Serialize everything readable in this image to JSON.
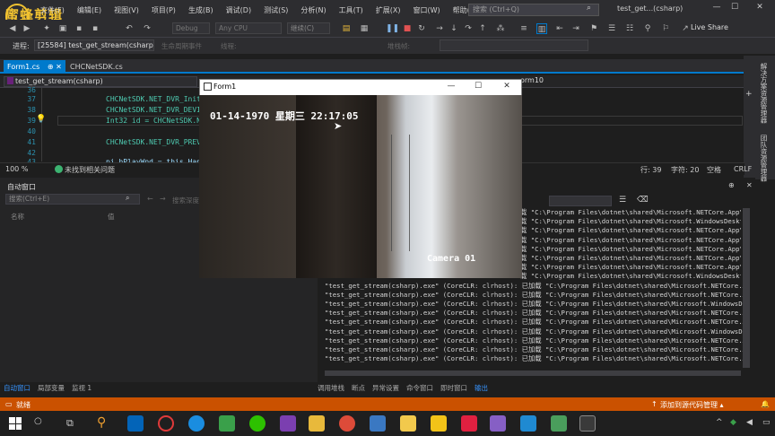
{
  "logo": {
    "text": "蜜蜂剪辑"
  },
  "menu": [
    "文件(F)",
    "编辑(E)",
    "视图(V)",
    "项目(P)",
    "生成(B)",
    "调试(D)",
    "测试(S)",
    "分析(N)",
    "工具(T)",
    "扩展(X)",
    "窗口(W)",
    "帮助(H)"
  ],
  "search": {
    "placeholder": "搜索 (Ctrl+Q)"
  },
  "window_title": "test_get...(csharp)",
  "toolbar": {
    "config": "Debug",
    "platform": "Any CPU",
    "continue": "继续(C)",
    "live_share": "Live Share"
  },
  "toolbar2": {
    "process_label": "进程:",
    "process": "[25584] test_get_stream(csharp",
    "lifecycle": "生命周期事件",
    "thread": "线程:",
    "stack": "堆栈帧:"
  },
  "tabs": [
    {
      "label": "Form1.cs",
      "pin": "⊕ ✕"
    },
    {
      "label": "CHCNetSDK.cs"
    }
  ],
  "nav": {
    "left": "test_get_stream(csharp)",
    "right": "orm10"
  },
  "editor": {
    "lines": [
      {
        "num": "36",
        "code": ""
      },
      {
        "num": "37",
        "code": "CHCNetSDK.NET_DVR_Init("
      },
      {
        "num": "38",
        "code": "CHCNetSDK.NET_DVR_DEVIC"
      },
      {
        "num": "39",
        "code": "Int32 id = CHCNetSDK.NE"
      },
      {
        "num": "40",
        "code": ""
      },
      {
        "num": "41",
        "code": "CHCNetSDK.NET_DVR_PREVI"
      },
      {
        "num": "42",
        "code": ""
      },
      {
        "num": "43",
        "code": "pi.hPlayWnd = this.Hand"
      }
    ]
  },
  "right_panel": {
    "solution": "解决方案资源管理器",
    "team": "团队资源管理器"
  },
  "editor_status": {
    "zoom": "100 %",
    "issues": "未找到相关问题",
    "line": "行: 39",
    "char": "字符: 20",
    "space": "空格",
    "eol": "CRLF"
  },
  "autos": {
    "title": "自动窗口",
    "search_placeholder": "搜索(Ctrl+E)",
    "search_depth": "搜索深度:",
    "col_name": "名称",
    "col_value": "值",
    "tabs": [
      "自动窗口",
      "局部变量",
      "监视 1"
    ]
  },
  "output": {
    "lines": [
      "载 \"C:\\Program Files\\dotnet\\shared\\Microsoft.NETCore.App\\3.1",
      "载 \"C:\\Program Files\\dotnet\\shared\\Microsoft.WindowsDesktop.A",
      "载 \"C:\\Program Files\\dotnet\\shared\\Microsoft.NETCore.App\\3.1",
      "载 \"C:\\Program Files\\dotnet\\shared\\Microsoft.NETCore.App\\3.1",
      "载 \"C:\\Program Files\\dotnet\\shared\\Microsoft.NETCore.App\\3.1",
      "载 \"C:\\Program Files\\dotnet\\shared\\Microsoft.NETCore.App\\3.1",
      "载 \"C:\\Program Files\\dotnet\\shared\\Microsoft.NETCore.App\\3.1",
      "载 \"C:\\Program Files\\dotnet\\shared\\Microsoft.WindowsDesktop.A",
      "\"test_get_stream(csharp).exe\" (CoreCLR: clrhost): 已加载 \"C:\\Program Files\\dotnet\\shared\\Microsoft.NETCore.App\\3.1",
      "\"test_get_stream(csharp).exe\" (CoreCLR: clrhost): 已加载 \"C:\\Program Files\\dotnet\\shared\\Microsoft.NETCore.App\\3.1",
      "\"test_get_stream(csharp).exe\" (CoreCLR: clrhost): 已加载 \"C:\\Program Files\\dotnet\\shared\\Microsoft.WindowsDesktop.A",
      "\"test_get_stream(csharp).exe\" (CoreCLR: clrhost): 已加载 \"C:\\Program Files\\dotnet\\shared\\Microsoft.NETCore.App\\3.1",
      "\"test_get_stream(csharp).exe\" (CoreCLR: clrhost): 已加载 \"C:\\Program Files\\dotnet\\shared\\Microsoft.NETCore.App\\3.1",
      "\"test_get_stream(csharp).exe\" (CoreCLR: clrhost): 已加载 \"C:\\Program Files\\dotnet\\shared\\Microsoft.WindowsDesktop.A",
      "\"test_get_stream(csharp).exe\" (CoreCLR: clrhost): 已加载 \"C:\\Program Files\\dotnet\\shared\\Microsoft.NETCore.App\\3.1",
      "\"test_get_stream(csharp).exe\" (CoreCLR: clrhost): 已加载 \"C:\\Program Files\\dotnet\\shared\\Microsoft.NETCore.App\\3.1",
      "\"test_get_stream(csharp).exe\" (CoreCLR: clrhost): 已加载 \"C:\\Program Files\\dotnet\\shared\\Microsoft.NETCore.App\\3.1"
    ],
    "tabs": [
      "调用堆栈",
      "断点",
      "异常设置",
      "命令窗口",
      "即时窗口",
      "输出"
    ]
  },
  "status": {
    "ready": "就绪",
    "source_control": "添加到源代码管理 ▴"
  },
  "form1": {
    "title": "Form1",
    "overlay_time": "01-14-1970 星期三 22:17:05",
    "overlay_cam": "Camera 01"
  },
  "colors": {
    "accent": "#007acc",
    "status_bar": "#ca5100",
    "logo": "#f1c230"
  }
}
